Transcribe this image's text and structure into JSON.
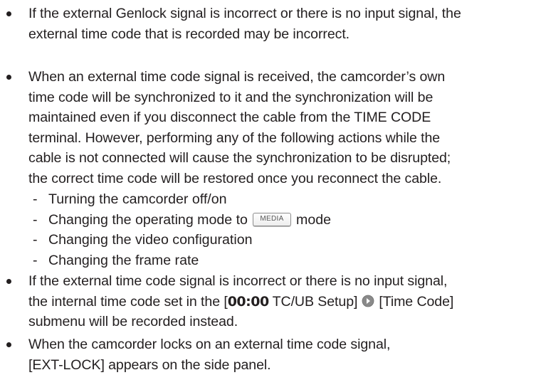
{
  "bullets": [
    {
      "lines": [
        "If the external Genlock signal is incorrect or there is no input signal, the",
        "external time code that is recorded may be incorrect."
      ]
    },
    {
      "lines": [
        "When an external time code signal is received, the camcorder’s own",
        "time code will be synchronized to it and the synchronization will be",
        "maintained even if you disconnect the cable from the TIME CODE",
        "terminal. However, performing any of the following actions while the",
        "cable is not connected will cause the synchronization to be disrupted;",
        "the correct time code will be restored once you reconnect the cable."
      ],
      "subitems": {
        "dash": "-",
        "item1": "Turning the camcorder off/on",
        "item2_before": "Changing the operating mode to",
        "item2_badge": "MEDIA",
        "item2_after": "mode",
        "item3": "Changing the video configuration",
        "item4": "Changing the frame rate"
      }
    },
    {
      "line1": "If the external time code signal is incorrect or there is no input signal,",
      "line2_before": "the internal time code set in the [",
      "line2_code": "00:00",
      "line2_mid": " TC/UB Setup]",
      "line2_after": "[Time Code]",
      "line3": "submenu will be recorded instead."
    },
    {
      "lines": [
        "When the camcorder locks on an external time code signal,",
        "[EXT-LOCK] appears on the side panel."
      ]
    }
  ],
  "icons": {
    "menu_arrow": "circle-arrow-right-icon",
    "bullet": "bullet-dot-icon"
  },
  "colors": {
    "text": "#231f20",
    "arrow_fill": "#8a8a8a",
    "badge_border": "#8c8c8c"
  }
}
